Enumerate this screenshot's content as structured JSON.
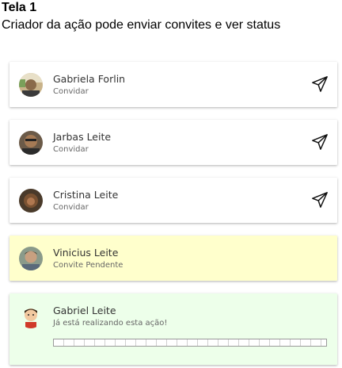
{
  "screen": {
    "title": "Tela 1",
    "subtitle": "Criador da ação pode enviar convites e ver status"
  },
  "invitees": [
    {
      "name": "Gabriela Forlin",
      "status": "Convidar",
      "state": "invite",
      "icon": "send-icon"
    },
    {
      "name": "Jarbas Leite",
      "status": "Convidar",
      "state": "invite",
      "icon": "send-icon"
    },
    {
      "name": "Cristina Leite",
      "status": "Convidar",
      "state": "invite",
      "icon": "send-icon"
    },
    {
      "name": "Vinicius Leite",
      "status": "Convite Pendente",
      "state": "pending"
    },
    {
      "name": "Gabriel Leite",
      "status": "Já está realizando esta ação!",
      "state": "active",
      "progress": 0
    }
  ],
  "colors": {
    "pending_bg": "#ffffcc",
    "active_bg": "#edffea"
  }
}
